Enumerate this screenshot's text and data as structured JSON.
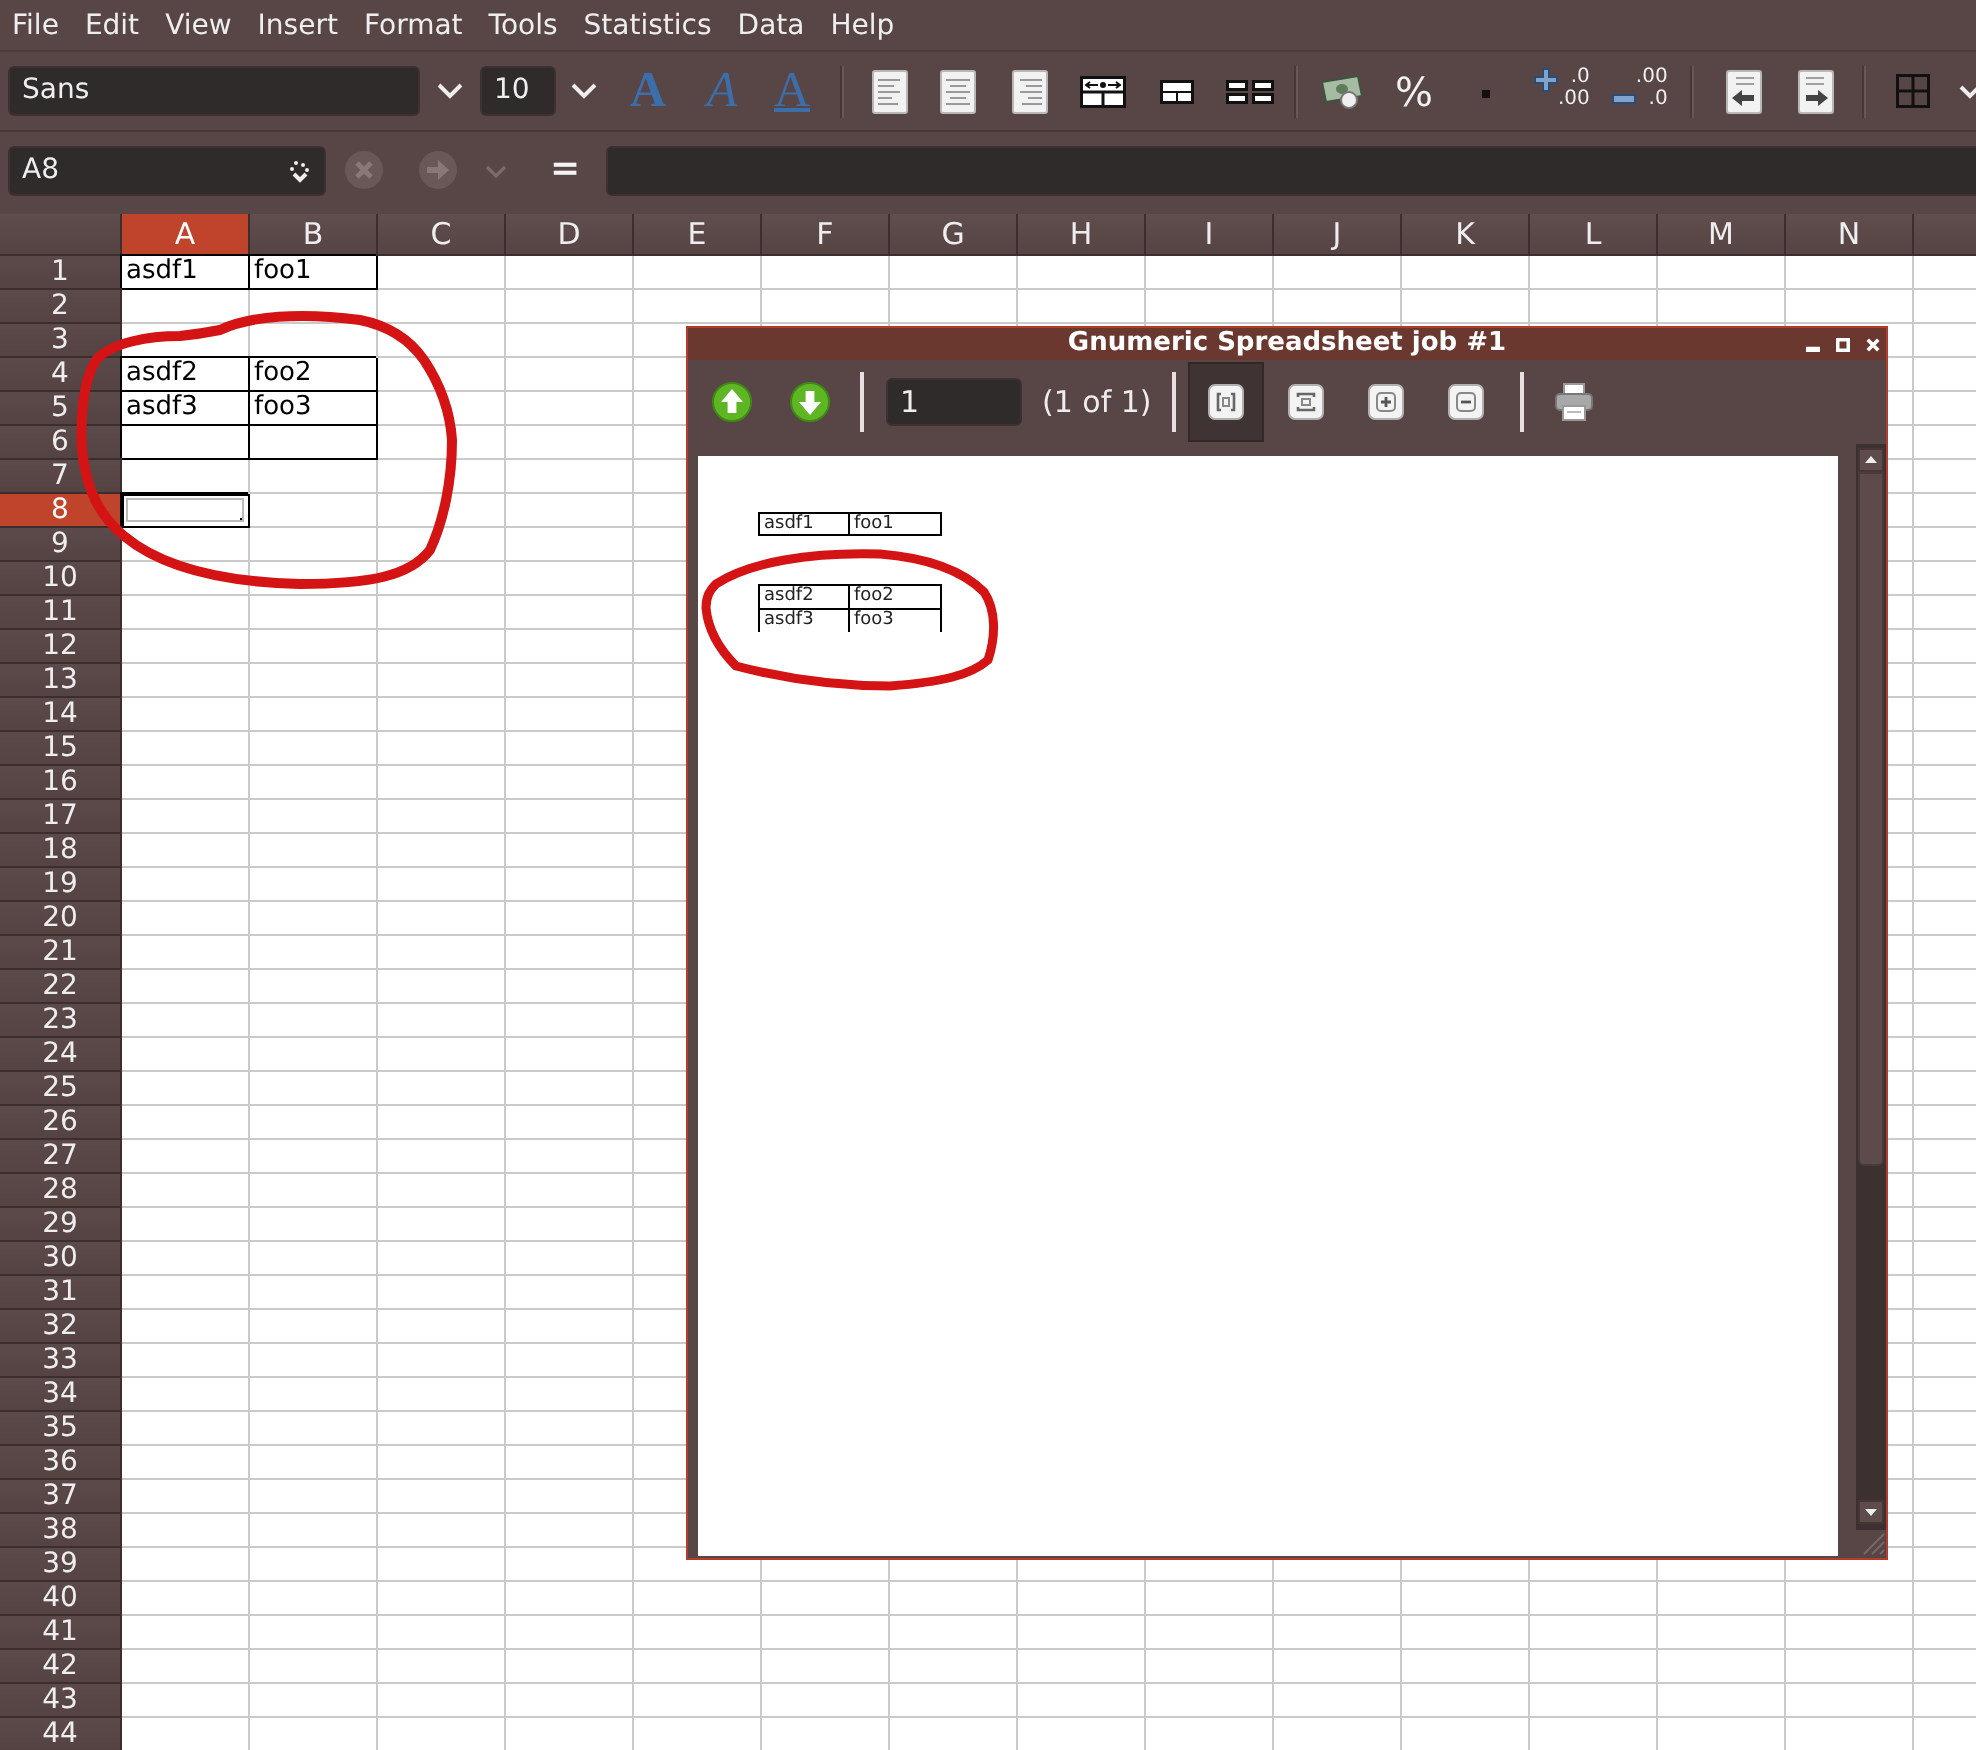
{
  "menu_bar": {
    "items": [
      "File",
      "Edit",
      "View",
      "Insert",
      "Format",
      "Tools",
      "Statistics",
      "Data",
      "Help"
    ]
  },
  "format_toolbar": {
    "font_name": "Sans",
    "font_size": "10",
    "style_buttons": [
      {
        "kind": "bold",
        "label": "A"
      },
      {
        "kind": "italic",
        "label": "A"
      },
      {
        "kind": "underline",
        "label": "A"
      }
    ],
    "number_buttons": [
      {
        "kind": "currency"
      },
      {
        "kind": "percent",
        "label": "%"
      },
      {
        "kind": "thousands"
      },
      {
        "kind": "add-decimal",
        "lines": [
          ".0",
          ".00"
        ]
      },
      {
        "kind": "remove-decimal",
        "lines": [
          ".00",
          ".0"
        ]
      }
    ]
  },
  "formula_bar": {
    "cell_name": "A8",
    "cancel_disabled": true,
    "accept_disabled": true,
    "equals_label": "="
  },
  "sheet": {
    "columns": [
      {
        "label": "A",
        "selected": true
      },
      {
        "label": "B",
        "selected": false
      },
      {
        "label": "C",
        "selected": false
      },
      {
        "label": "D",
        "selected": false
      },
      {
        "label": "E",
        "selected": false
      },
      {
        "label": "F",
        "selected": false
      },
      {
        "label": "G",
        "selected": false
      },
      {
        "label": "H",
        "selected": false
      },
      {
        "label": "I",
        "selected": false
      },
      {
        "label": "J",
        "selected": false
      },
      {
        "label": "K",
        "selected": false
      },
      {
        "label": "L",
        "selected": false
      },
      {
        "label": "M",
        "selected": false
      },
      {
        "label": "N",
        "selected": false
      },
      {
        "selected": false
      }
    ],
    "rows": [
      {
        "label": "1",
        "selected": false,
        "cells": [
          {
            "text": "asdf1",
            "bordered": true
          },
          {
            "text": "foo1",
            "bordered": true
          }
        ]
      },
      {
        "label": "2",
        "selected": false
      },
      {
        "label": "3",
        "selected": false
      },
      {
        "label": "4",
        "selected": false,
        "cells": [
          {
            "text": "asdf2",
            "bordered": true
          },
          {
            "text": "foo2",
            "bordered": true
          }
        ]
      },
      {
        "label": "5",
        "selected": false,
        "cells": [
          {
            "text": "asdf3",
            "bordered": true
          },
          {
            "text": "foo3",
            "bordered": true
          }
        ]
      },
      {
        "label": "6",
        "selected": false,
        "cells": [
          {
            "bordered": true
          },
          {
            "bordered": true
          }
        ]
      },
      {
        "label": "7",
        "selected": false
      },
      {
        "label": "8",
        "selected": true
      },
      {
        "label": "9",
        "selected": false
      },
      {
        "label": "10",
        "selected": false
      },
      {
        "label": "11",
        "selected": false
      },
      {
        "label": "12",
        "selected": false
      },
      {
        "label": "13",
        "selected": false
      },
      {
        "label": "14",
        "selected": false
      },
      {
        "label": "15",
        "selected": false
      },
      {
        "label": "16",
        "selected": false
      },
      {
        "label": "17",
        "selected": false
      },
      {
        "label": "18",
        "selected": false
      },
      {
        "label": "19",
        "selected": false
      },
      {
        "label": "20",
        "selected": false
      },
      {
        "label": "21",
        "selected": false
      },
      {
        "label": "22",
        "selected": false
      },
      {
        "label": "23",
        "selected": false
      },
      {
        "label": "24",
        "selected": false
      },
      {
        "label": "25",
        "selected": false
      },
      {
        "label": "26",
        "selected": false
      },
      {
        "label": "27",
        "selected": false
      },
      {
        "label": "28",
        "selected": false
      },
      {
        "label": "29",
        "selected": false
      },
      {
        "label": "30",
        "selected": false
      },
      {
        "label": "31",
        "selected": false
      },
      {
        "label": "32",
        "selected": false
      },
      {
        "label": "33",
        "selected": false
      },
      {
        "label": "34",
        "selected": false
      },
      {
        "label": "35",
        "selected": false
      },
      {
        "label": "36",
        "selected": false
      },
      {
        "label": "37",
        "selected": false
      },
      {
        "label": "38",
        "selected": false
      },
      {
        "label": "39",
        "selected": false
      },
      {
        "label": "40",
        "selected": false
      },
      {
        "label": "41",
        "selected": false
      },
      {
        "label": "42",
        "selected": false
      },
      {
        "label": "43",
        "selected": false
      },
      {
        "label": "44",
        "selected": false
      }
    ],
    "annotations": [
      {
        "kind": "freehand-loop"
      }
    ]
  },
  "print_preview": {
    "title": "Gnumeric Spreadsheet job #1",
    "page_field": "1",
    "page_count": "(1 of 1)",
    "zoom_buttons": [
      {
        "kind": "fit-page",
        "selected": true
      },
      {
        "kind": "fit-width",
        "selected": false
      },
      {
        "kind": "zoom-in",
        "selected": false
      },
      {
        "kind": "zoom-out",
        "selected": false
      }
    ],
    "page_rows": [
      {
        "kind": "data",
        "cells": [
          "asdf1",
          "foo1"
        ],
        "bottom_border": true
      },
      {
        "kind": "blank"
      },
      {
        "kind": "blank"
      },
      {
        "kind": "data",
        "cells": [
          "asdf2",
          "foo2"
        ],
        "bottom_border": false
      },
      {
        "kind": "data",
        "cells": [
          "asdf3",
          "foo3"
        ],
        "bottom_border": false
      }
    ],
    "annotations": [
      {
        "kind": "freehand-loop"
      }
    ]
  }
}
